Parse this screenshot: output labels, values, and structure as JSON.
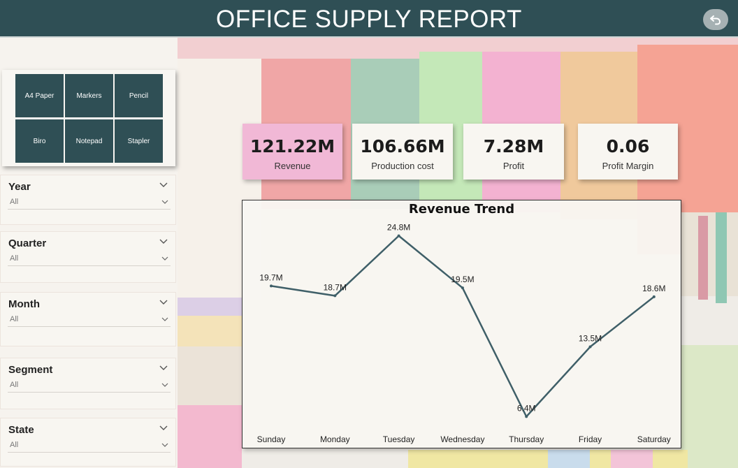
{
  "header": {
    "title": "OFFICE SUPPLY REPORT",
    "bg_color": "#2f4f55",
    "back_icon": "undo-arrow-icon"
  },
  "products": [
    "A4 Paper",
    "Markers",
    "Pencil",
    "Biro",
    "Notepad",
    "Stapler"
  ],
  "slicers": [
    {
      "title": "Year",
      "value": "All"
    },
    {
      "title": "Quarter",
      "value": "All"
    },
    {
      "title": "Month",
      "value": "All"
    },
    {
      "title": "Segment",
      "value": "All"
    },
    {
      "title": "State",
      "value": "All"
    }
  ],
  "kpis": [
    {
      "value": "121.22M",
      "label": "Revenue",
      "highlight": true
    },
    {
      "value": "106.66M",
      "label": "Production cost",
      "highlight": false
    },
    {
      "value": "7.28M",
      "label": "Profit",
      "highlight": false
    },
    {
      "value": "0.06",
      "label": "Profit Margin",
      "highlight": false
    }
  ],
  "colors": {
    "accent": "#2f4f55",
    "kpi_highlight": "#f1b8d6",
    "line": "#3f5f68"
  },
  "chart_data": {
    "type": "line",
    "title": "Revenue Trend",
    "categories": [
      "Sunday",
      "Monday",
      "Tuesday",
      "Wednesday",
      "Thursday",
      "Friday",
      "Saturday"
    ],
    "values": [
      19.7,
      18.7,
      24.8,
      19.5,
      6.4,
      13.5,
      18.6
    ],
    "data_labels": [
      "19.7M",
      "18.7M",
      "24.8M",
      "19.5M",
      "6.4M",
      "13.5M",
      "18.6M"
    ],
    "xlabel": "",
    "ylabel": "",
    "grid": false,
    "legend": "none"
  }
}
